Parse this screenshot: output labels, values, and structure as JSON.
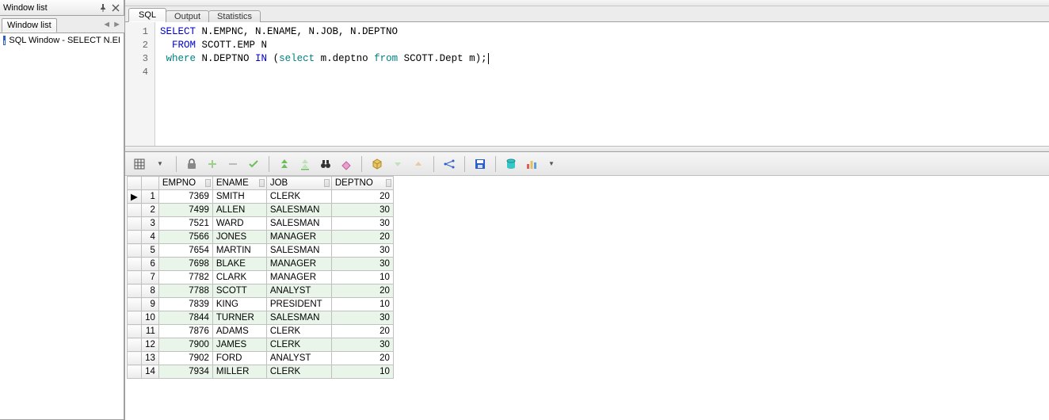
{
  "sidebar": {
    "title": "Window list",
    "tab_label": "Window list",
    "tree_item_label": "SQL Window - SELECT N.EI"
  },
  "doc_tabs": [
    {
      "label": "SQL",
      "active": true
    },
    {
      "label": "Output",
      "active": false
    },
    {
      "label": "Statistics",
      "active": false
    }
  ],
  "sql_lines": [
    {
      "n": "1",
      "tokens": [
        {
          "t": "SELECT",
          "c": "kw-blue"
        },
        {
          "t": " N.EMPNC, N.ENAME, N.JOB, N.DEPTNO",
          "c": "kw-black"
        }
      ]
    },
    {
      "n": "2",
      "tokens": [
        {
          "t": "  ",
          "c": "kw-black"
        },
        {
          "t": "FROM",
          "c": "kw-blue"
        },
        {
          "t": " SCOTT.EMP N",
          "c": "kw-black"
        }
      ]
    },
    {
      "n": "3",
      "tokens": [
        {
          "t": " ",
          "c": "kw-black"
        },
        {
          "t": "where",
          "c": "kw-teal"
        },
        {
          "t": " N.DEPTNO ",
          "c": "kw-black"
        },
        {
          "t": "IN",
          "c": "kw-blue"
        },
        {
          "t": " (",
          "c": "kw-black"
        },
        {
          "t": "select",
          "c": "kw-teal"
        },
        {
          "t": " m.deptno ",
          "c": "kw-black"
        },
        {
          "t": "from",
          "c": "kw-teal"
        },
        {
          "t": " SCOTT.Dept m);",
          "c": "kw-black"
        }
      ],
      "cursor": true
    },
    {
      "n": "4",
      "tokens": []
    }
  ],
  "toolbar_icons": [
    "grid-format-icon",
    "dropdown-icon",
    "sep",
    "lock-icon",
    "plus-icon",
    "minus-icon",
    "check-icon",
    "sep",
    "fetch-next-icon",
    "fetch-all-icon",
    "binoculars-icon",
    "eraser-icon",
    "sep",
    "cube-icon",
    "down-arrow-icon",
    "up-arrow-icon",
    "sep",
    "link-icon",
    "sep",
    "save-icon",
    "sep",
    "db-icon",
    "chart-icon",
    "dropdown2-icon"
  ],
  "columns": [
    {
      "key": "empno",
      "label": "EMPNO",
      "class": "col-empno num"
    },
    {
      "key": "ename",
      "label": "ENAME",
      "class": "col-ename"
    },
    {
      "key": "job",
      "label": "JOB",
      "class": "col-job"
    },
    {
      "key": "deptno",
      "label": "DEPTNO",
      "class": "col-deptno num"
    }
  ],
  "rows": [
    {
      "empno": "7369",
      "ename": "SMITH",
      "job": "CLERK",
      "deptno": "20"
    },
    {
      "empno": "7499",
      "ename": "ALLEN",
      "job": "SALESMAN",
      "deptno": "30"
    },
    {
      "empno": "7521",
      "ename": "WARD",
      "job": "SALESMAN",
      "deptno": "30"
    },
    {
      "empno": "7566",
      "ename": "JONES",
      "job": "MANAGER",
      "deptno": "20"
    },
    {
      "empno": "7654",
      "ename": "MARTIN",
      "job": "SALESMAN",
      "deptno": "30"
    },
    {
      "empno": "7698",
      "ename": "BLAKE",
      "job": "MANAGER",
      "deptno": "30"
    },
    {
      "empno": "7782",
      "ename": "CLARK",
      "job": "MANAGER",
      "deptno": "10"
    },
    {
      "empno": "7788",
      "ename": "SCOTT",
      "job": "ANALYST",
      "deptno": "20"
    },
    {
      "empno": "7839",
      "ename": "KING",
      "job": "PRESIDENT",
      "deptno": "10"
    },
    {
      "empno": "7844",
      "ename": "TURNER",
      "job": "SALESMAN",
      "deptno": "30"
    },
    {
      "empno": "7876",
      "ename": "ADAMS",
      "job": "CLERK",
      "deptno": "20"
    },
    {
      "empno": "7900",
      "ename": "JAMES",
      "job": "CLERK",
      "deptno": "30"
    },
    {
      "empno": "7902",
      "ename": "FORD",
      "job": "ANALYST",
      "deptno": "20"
    },
    {
      "empno": "7934",
      "ename": "MILLER",
      "job": "CLERK",
      "deptno": "10"
    }
  ],
  "active_row_index": 0
}
